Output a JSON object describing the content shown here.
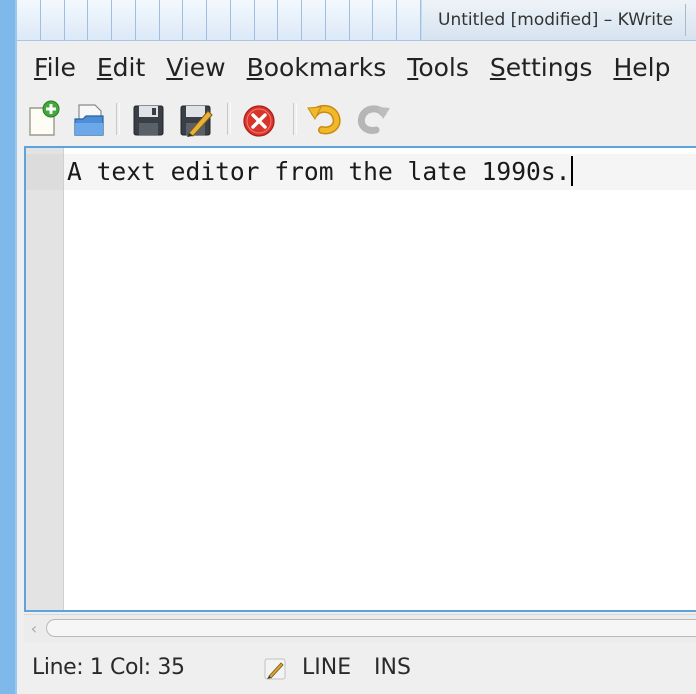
{
  "window": {
    "title": "Untitled [modified] – KWrite"
  },
  "menubar": {
    "items": [
      {
        "key": "F",
        "rest": "ile"
      },
      {
        "key": "E",
        "rest": "dit"
      },
      {
        "key": "V",
        "rest": "iew"
      },
      {
        "key": "B",
        "rest": "ookmarks"
      },
      {
        "key": "T",
        "rest": "ools"
      },
      {
        "key": "S",
        "rest": "ettings"
      },
      {
        "key": "H",
        "rest": "elp"
      }
    ]
  },
  "toolbar": {
    "icons": [
      "new-document-icon",
      "open-document-icon",
      "save-icon",
      "save-as-icon",
      "close-icon",
      "undo-icon",
      "redo-icon"
    ]
  },
  "editor": {
    "text": "A text editor from the late 1990s."
  },
  "statusbar": {
    "position": "Line: 1 Col: 35",
    "mode": "LINE",
    "input_mode": "INS"
  },
  "colors": {
    "accent": "#5fa3dd",
    "desktop": "#7fb8ea",
    "close_red": "#d9342b",
    "undo_yellow": "#f0b82b"
  }
}
